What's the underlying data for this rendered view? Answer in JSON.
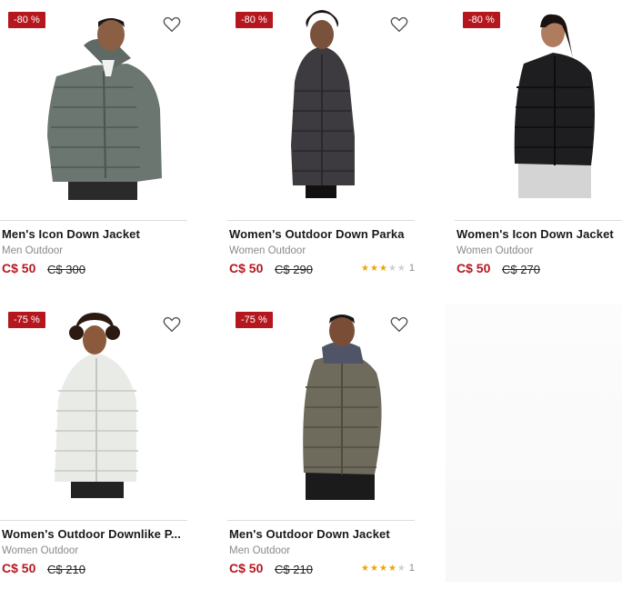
{
  "products": [
    {
      "badge": "-80 %",
      "name": "Men's Icon Down Jacket",
      "category": "Men Outdoor",
      "sale_price": "C$ 50",
      "original_price": "C$ 300",
      "jacket_color": "#6b7670",
      "stars": null,
      "rating_count": ""
    },
    {
      "badge": "-80 %",
      "name": "Women's Outdoor Down Parka",
      "category": "Women Outdoor",
      "sale_price": "C$ 50",
      "original_price": "C$ 290",
      "jacket_color": "#3d3b40",
      "stars": 3,
      "rating_count": "1"
    },
    {
      "badge": "-80 %",
      "name": "Women's Icon Down Jacket",
      "category": "Women Outdoor",
      "sale_price": "C$ 50",
      "original_price": "C$ 270",
      "jacket_color": "#1e1e20",
      "stars": null,
      "rating_count": ""
    },
    {
      "badge": "-75 %",
      "name": "Women's Outdoor Downlike P...",
      "category": "Women Outdoor",
      "sale_price": "C$ 50",
      "original_price": "C$ 210",
      "jacket_color": "#e9ebe7",
      "stars": null,
      "rating_count": ""
    },
    {
      "badge": "-75 %",
      "name": "Men's Outdoor Down Jacket",
      "category": "Men Outdoor",
      "sale_price": "C$ 50",
      "original_price": "C$ 210",
      "jacket_color": "#6e6a5c",
      "stars": 4,
      "rating_count": "1"
    }
  ],
  "colors": {
    "accent": "#b5171f",
    "star": "#f0a500"
  }
}
